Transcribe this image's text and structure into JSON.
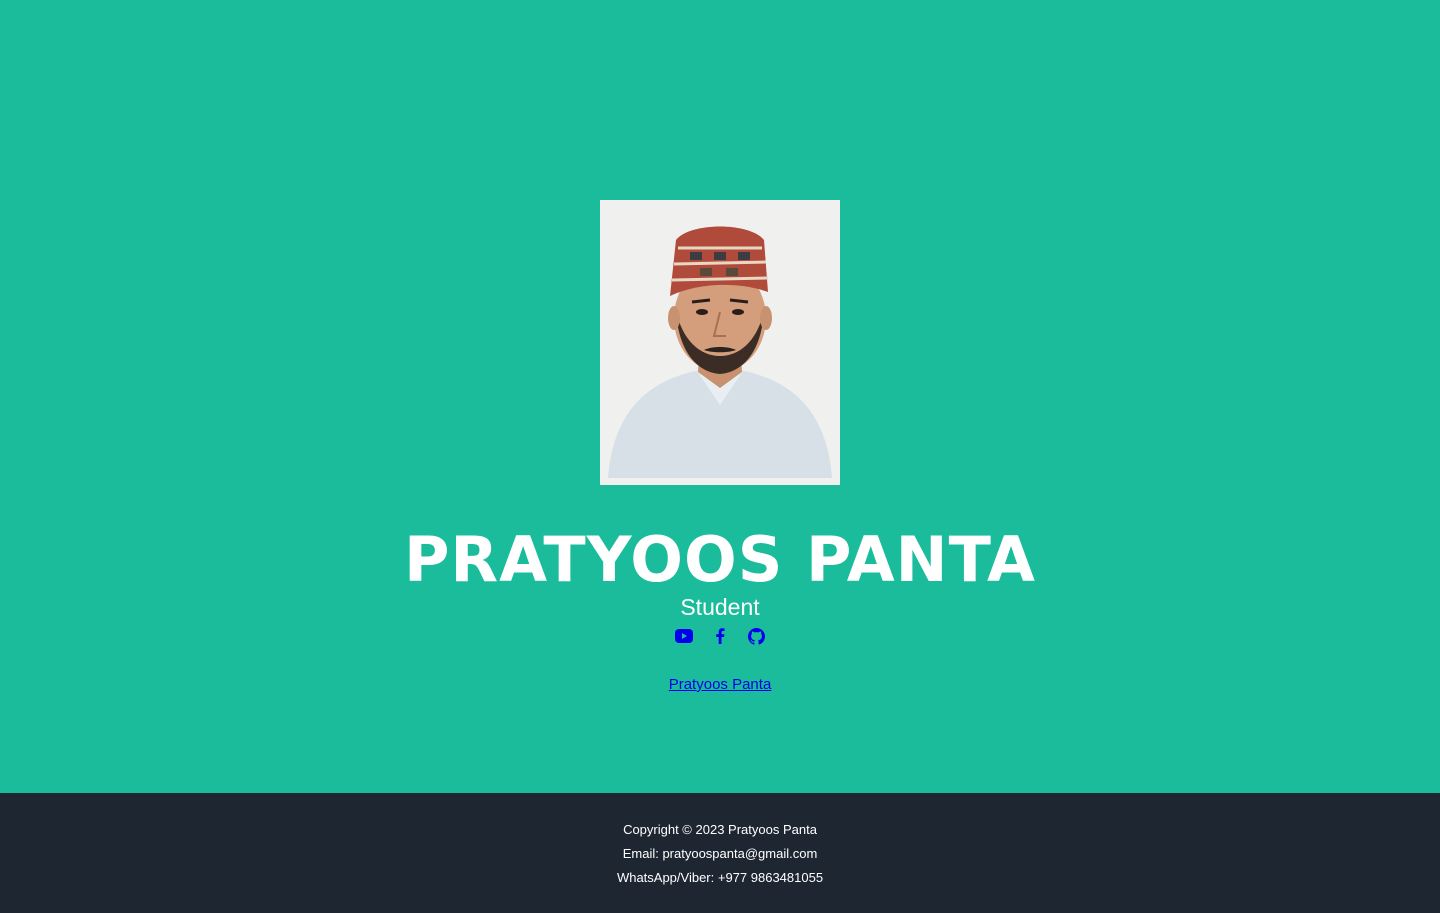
{
  "hero": {
    "name": "PRATYOOS PANTA",
    "role": "Student",
    "profile_photo_alt": "Pratyoos Panta",
    "profile_link_text": "Pratyoos Panta",
    "socials": [
      {
        "icon": "youtube-icon"
      },
      {
        "icon": "facebook-icon"
      },
      {
        "icon": "github-icon"
      }
    ]
  },
  "footer": {
    "copyright": "Copyright © 2023 Pratyoos Panta",
    "email": "Email: pratyoospanta@gmail.com",
    "phone": "WhatsApp/Viber: +977 9863481055"
  },
  "colors": {
    "background": "#1abc9c",
    "footer_background": "#1e2631",
    "text": "#ffffff",
    "link": "#0000ee"
  }
}
